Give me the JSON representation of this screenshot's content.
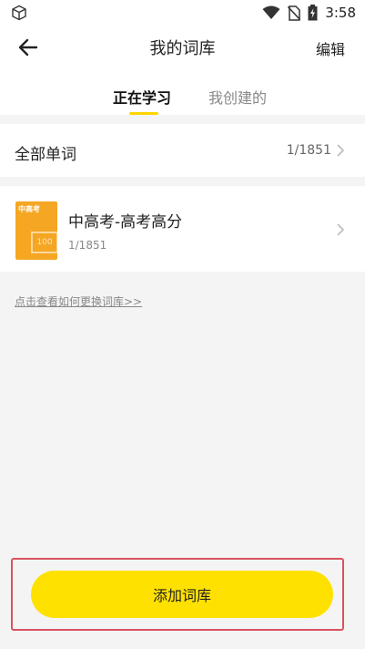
{
  "status_bar": {
    "time": "3:58",
    "icons": [
      "box-icon",
      "wifi-icon",
      "no-sim-icon",
      "battery-charging-icon"
    ]
  },
  "app_bar": {
    "back_icon": "arrow-left-icon",
    "title": "我的词库",
    "edit_label": "编辑"
  },
  "tabs": [
    {
      "label": "正在学习",
      "active": true
    },
    {
      "label": "我创建的",
      "active": false
    }
  ],
  "all_words": {
    "label": "全部单词",
    "count": "1/1851"
  },
  "book": {
    "cover_badge": "中高考",
    "cover_score": "100",
    "name": "中高考-高考高分",
    "progress": "1/1851"
  },
  "help_link": "点击查看如何更换词库>>",
  "add_button_label": "添加词库",
  "colors": {
    "accent_yellow": "#ffe100",
    "tab_indicator": "#ffd600",
    "cover_orange": "#f5a623",
    "highlight_border": "#d9535e"
  }
}
